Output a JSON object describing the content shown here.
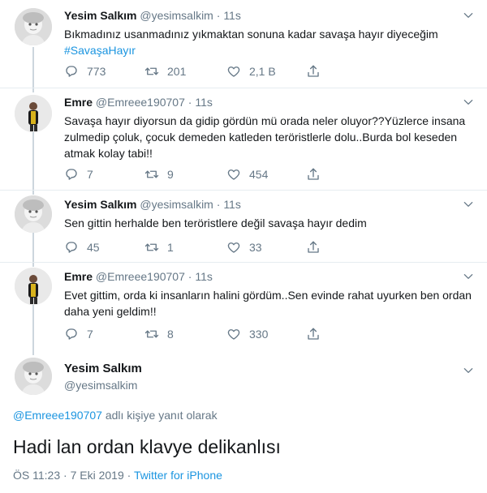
{
  "tweets": [
    {
      "name": "Yesim Salkım",
      "handle": "@yesimsalkim",
      "dot": "·",
      "time": "11s",
      "text": "Bıkmadınız usanmadınız yıkmaktan sonuna kadar savaşa hayır diyeceğim",
      "hashtag": "#SavaşaHayır",
      "replies": "773",
      "retweets": "201",
      "likes": "2,1 B"
    },
    {
      "name": "Emre",
      "handle": "@Emreee190707",
      "dot": "·",
      "time": "11s",
      "text": "Savaşa hayır diyorsun da gidip gördün mü orada neler oluyor??Yüzlerce insana zulmedip çoluk, çocuk demeden katleden teröristlerle dolu..Burda bol keseden atmak kolay tabi!!",
      "replies": "7",
      "retweets": "9",
      "likes": "454"
    },
    {
      "name": "Yesim Salkım",
      "handle": "@yesimsalkim",
      "dot": "·",
      "time": "11s",
      "text": "Sen gittin herhalde ben teröristlere değil savaşa hayır dedim",
      "replies": "45",
      "retweets": "1",
      "likes": "33"
    },
    {
      "name": "Emre",
      "handle": "@Emreee190707",
      "dot": "·",
      "time": "11s",
      "text": "Evet gittim, orda ki insanların halini gördüm..Sen evinde rahat uyurken ben ordan daha yeni geldim!!",
      "replies": "7",
      "retweets": "8",
      "likes": "330"
    }
  ],
  "main": {
    "name": "Yesim Salkım",
    "handle": "@yesimsalkim",
    "replying_to": "@Emreee190707",
    "replying_suffix": " adlı kişiye yanıt olarak",
    "text": "Hadi lan ordan klavye delikanlısı",
    "time": "ÖS 11:23",
    "date": "7 Eki 2019",
    "sep1": " · ",
    "sep2": " · ",
    "source": "Twitter for iPhone"
  },
  "icons": {
    "reply": "reply-icon",
    "retweet": "retweet-icon",
    "like": "heart-icon",
    "share": "share-icon",
    "caret": "chevron-down-icon"
  },
  "colors": {
    "link": "#1b95e0",
    "muted": "#657786",
    "divider": "#e6ecf0",
    "thread_line": "#ccd6dd"
  }
}
